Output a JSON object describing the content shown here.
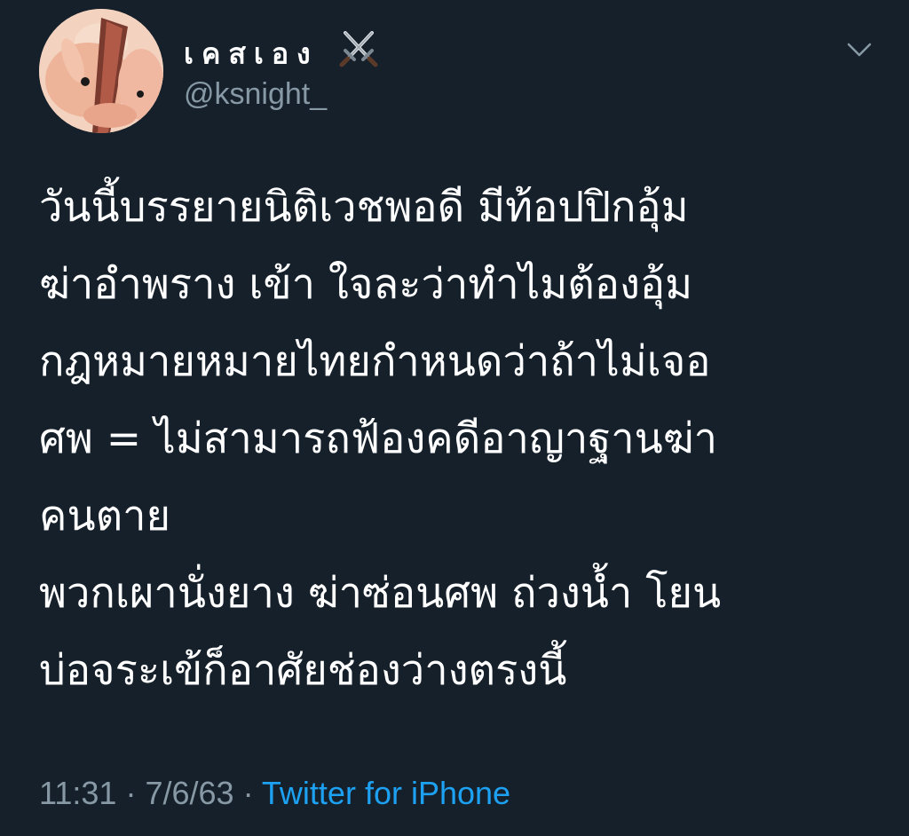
{
  "tweet": {
    "author": {
      "display_name": "เคสเอง",
      "emoji_icon": "crossed-swords-icon",
      "handle": "@ksnight_"
    },
    "lines": [
      "วันนี้บรรยายนิติเวชพอดี มีท้อปปิกอุ้ม",
      "ฆ่าอำพราง เข้า ใจละว่าทำไมต้องอุ้ม",
      "กฎหมายหมายไทยกำหนดว่าถ้าไม่เจอ",
      "ศพ = ไม่สามารถฟ้องคดีอาญาฐานฆ่า",
      "คนตาย",
      "พวกเผานั่งยาง ฆ่าซ่อนศพ ถ่วงน้ำ โยน",
      "บ่อจระเข้ก็อาศัยช่องว่างตรงนี้"
    ],
    "time": "11:31",
    "separator": "·",
    "date": "7/6/63",
    "source": "Twitter for iPhone"
  },
  "colors": {
    "background": "#15202b",
    "text": "#ffffff",
    "secondary": "#8899a6",
    "link": "#1da1f2"
  }
}
